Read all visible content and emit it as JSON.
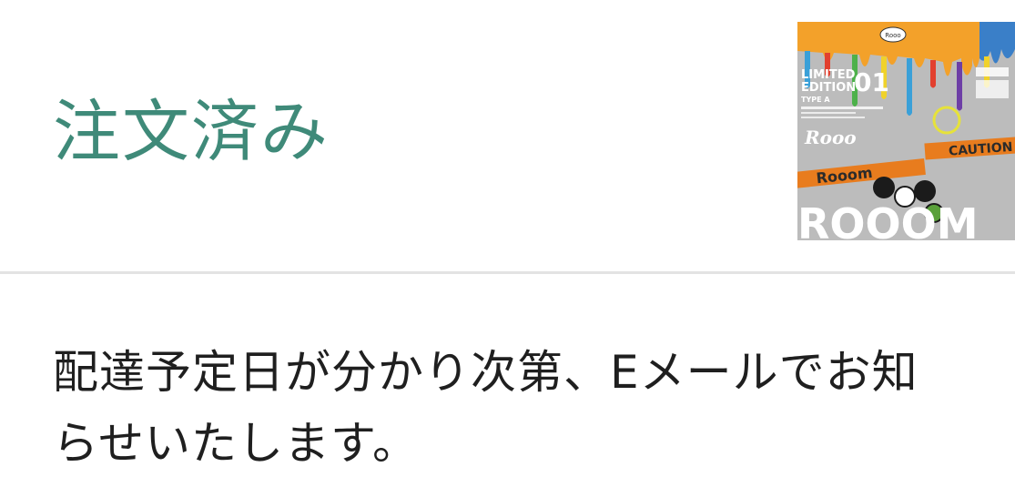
{
  "order": {
    "status_title": "注文済み",
    "delivery_message_line1": "配達予定日が分かり次第、Eメールでお知",
    "delivery_message_line2": "らせいたします。"
  },
  "product_thumbnail": {
    "badge_text": "Rooo",
    "edition_text_1": "LIMITED",
    "edition_text_2": "EDITION",
    "edition_number": "01",
    "type_text": "TYPE A",
    "band_text": "Rooom",
    "caution_text": "CAUTION",
    "logo_text": "ROOOM",
    "colors": {
      "background": "#b9b9b9",
      "drip_orange": "#f3a12a",
      "tape_orange": "#e87c1e",
      "tape_text": "#2b2b2b"
    }
  }
}
